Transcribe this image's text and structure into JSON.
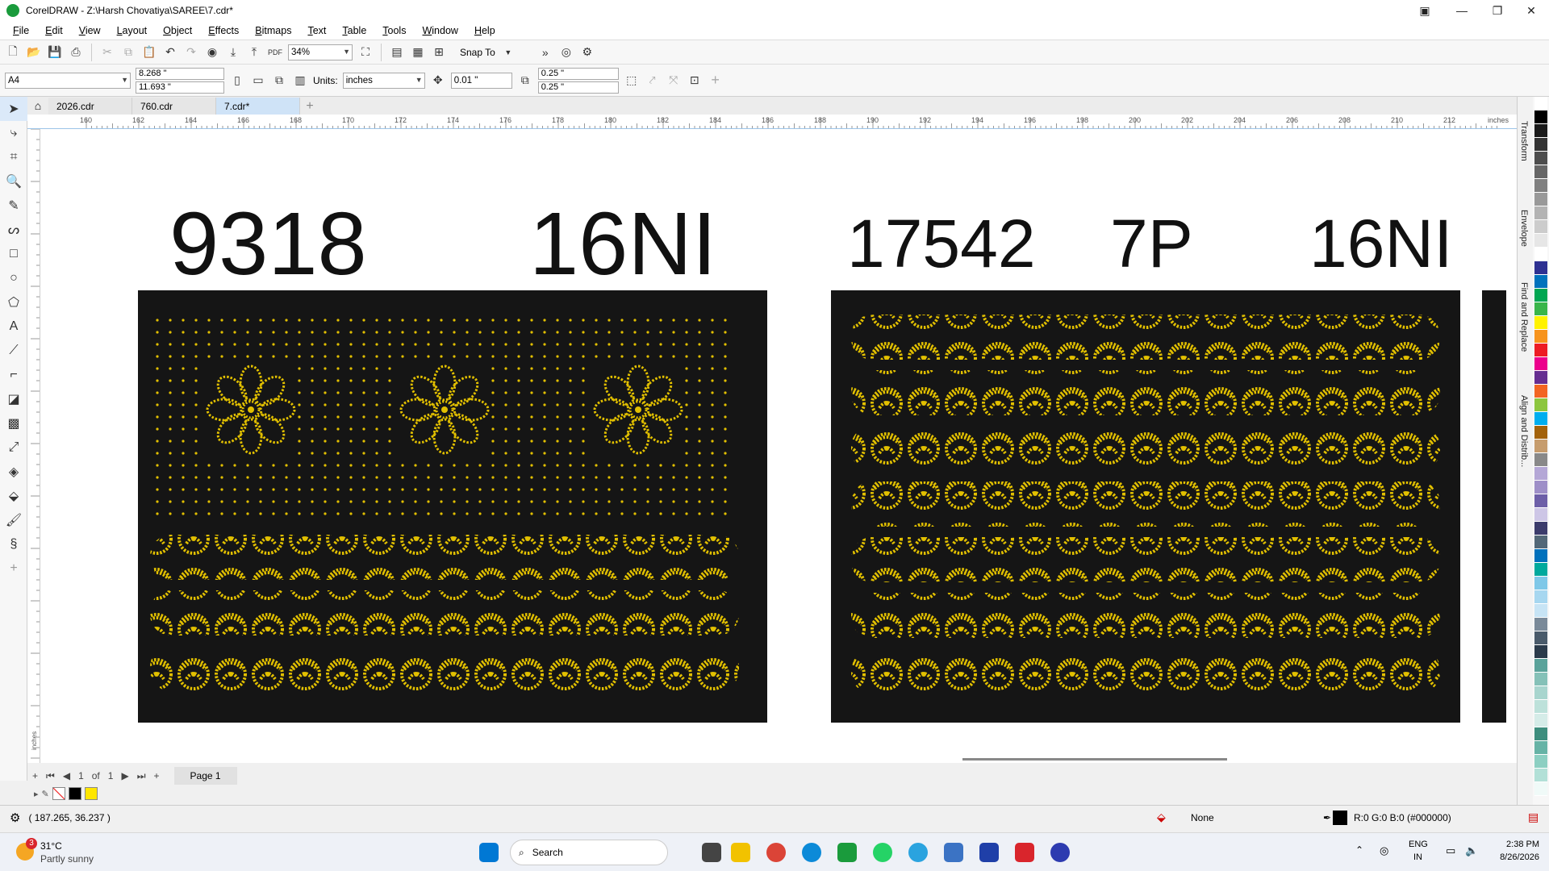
{
  "window": {
    "title": "CorelDRAW - Z:\\Harsh Chovatiya\\SAREE\\7.cdr*"
  },
  "menu": [
    "File",
    "Edit",
    "View",
    "Layout",
    "Object",
    "Effects",
    "Bitmaps",
    "Text",
    "Table",
    "Tools",
    "Window",
    "Help"
  ],
  "toolbar": {
    "zoom": "34%",
    "snap_to": "Snap To"
  },
  "properties": {
    "page_size": "A4",
    "width": "8.268 \"",
    "height": "11.693 \"",
    "units_label": "Units:",
    "units": "inches",
    "nudge": "0.01 \"",
    "dup_x": "0.25 \"",
    "dup_y": "0.25 \""
  },
  "tabs": [
    "2026.cdr",
    "760.cdr",
    "7.cdr*"
  ],
  "ruler": {
    "h_labels": [
      "160",
      "162",
      "164",
      "166",
      "168",
      "170",
      "172",
      "174",
      "176",
      "178",
      "180",
      "182",
      "184",
      "186",
      "188",
      "190",
      "192",
      "194",
      "196",
      "198",
      "200",
      "202",
      "204",
      "206",
      "208",
      "210",
      "212"
    ],
    "unit": "inches",
    "v_unit": "inches"
  },
  "canvas": {
    "labels": [
      "9318",
      "16NI",
      "17542",
      "7P",
      "16NI"
    ]
  },
  "page_nav": {
    "current": "1",
    "of_label": "of",
    "total": "1",
    "page_tab": "Page 1"
  },
  "status": {
    "coords": "( 187.265, 36.237 )",
    "fill": "None",
    "outline_color": "R:0 G:0 B:0 (#000000)"
  },
  "dockers": [
    "Transform",
    "Envelope",
    "Find and Replace",
    "Align and Distrib..."
  ],
  "colors": {
    "panel": "#151515",
    "gold": "#e2c000",
    "accent": "#1a9b3c"
  },
  "taskbar": {
    "weather_temp": "31°C",
    "weather_desc": "Partly sunny",
    "weather_badge": "3",
    "search": "Search",
    "lang": "ENG",
    "region": "IN",
    "time": "2:38 PM",
    "date": "8/26/2026"
  }
}
